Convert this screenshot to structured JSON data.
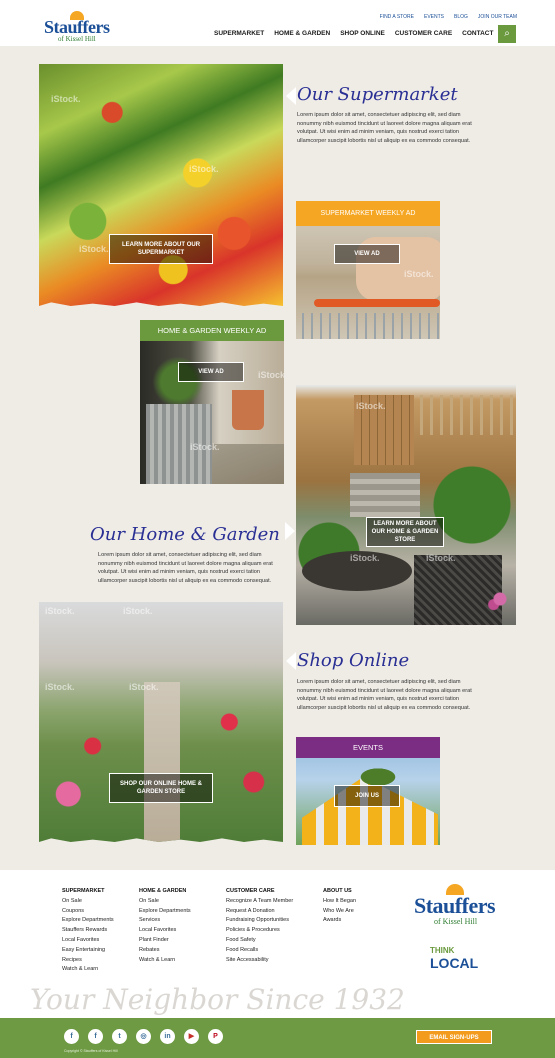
{
  "header": {
    "logo_text": "Stauffers",
    "logo_sub": "of Kissel Hill",
    "utility_links": [
      "FIND A STORE",
      "EVENTS",
      "BLOG",
      "JOIN OUR TEAM"
    ],
    "nav": [
      "SUPERMARKET",
      "HOME & GARDEN",
      "SHOP ONLINE",
      "CUSTOMER CARE",
      "CONTACT"
    ],
    "search_icon": "⌕"
  },
  "watermark": "iStock.",
  "supermarket": {
    "title": "Our Supermarket",
    "body": "Lorem ipsum dolor sit amet, consectetuer adipiscing elit, sed diam nonummy nibh euismod tincidunt ut laoreet dolore magna aliquam erat volutpat. Ut wisi enim ad minim veniam, quis nostrud exerci tation ullamcorper suscipit lobortis nisl ut aliquip ex ea commodo consequat.",
    "button": "LEARN MORE ABOUT OUR SUPERMARKET"
  },
  "supermarket_ad": {
    "label": "SUPERMARKET WEEKLY AD",
    "button": "VIEW AD"
  },
  "garden_ad": {
    "label": "HOME & GARDEN WEEKLY AD",
    "button": "VIEW AD"
  },
  "home_garden": {
    "title": "Our Home & Garden",
    "body": "Lorem ipsum dolor sit amet, consectetuer adipiscing elit, sed diam nonummy nibh euismod tincidunt ut laoreet dolore magna aliquam erat volutpat. Ut wisi enim ad minim veniam, quis nostrud exerci tation ullamcorper suscipit lobortis nisl ut aliquip ex ea commodo consequat.",
    "button": "LEARN MORE ABOUT OUR HOME & GARDEN STORE"
  },
  "shop_online": {
    "title": "Shop Online",
    "body": "Lorem ipsum dolor sit amet, consectetuer adipiscing elit, sed diam nonummy nibh euismod tincidunt ut laoreet dolore magna aliquam erat volutpat. Ut wisi enim ad minim veniam, quis nostrud exerci tation ullamcorper suscipit lobortis nisl ut aliquip ex ea commodo consequat.",
    "button": "SHOP OUR ONLINE HOME & GARDEN STORE"
  },
  "events": {
    "label": "EVENTS",
    "button": "JOIN US"
  },
  "footer": {
    "columns": [
      {
        "heading": "SUPERMARKET",
        "links": [
          "On Sale",
          "Coupons",
          "Explore Departments",
          "Stauffers Rewards",
          "Local Favorites",
          "Easy Entertaining",
          "Recipes",
          "Watch & Learn"
        ]
      },
      {
        "heading": "HOME & GARDEN",
        "links": [
          "On Sale",
          "Explore Departments",
          "Services",
          "Local Favorites",
          "Plant Finder",
          "Rebates",
          "Watch & Learn"
        ]
      },
      {
        "heading": "CUSTOMER CARE",
        "links": [
          "Recognize A Team Member",
          "Request A Donation",
          "Fundraising Opportunities",
          "Policies & Procedures",
          "Food Safety",
          "Food Recalls",
          "Site Accessability"
        ]
      },
      {
        "heading": "ABOUT US",
        "links": [
          "How It Began",
          "Who We Are",
          "Awards"
        ]
      }
    ],
    "logo_text": "Stauffers",
    "logo_sub": "of Kissel Hill",
    "think_local_1": "THINK",
    "think_local_2": "LOCAL",
    "slogan": "Your Neighbor Since 1932",
    "social": [
      "f",
      "f",
      "t",
      "◎",
      "in",
      "▶",
      "P"
    ],
    "email_button": "EMAIL SIGN-UPS",
    "legal": "Copyright © Stauffers of Kissel Hill"
  },
  "colors": {
    "orange": "#f5a623",
    "green": "#6b9a3e",
    "purple": "#7b2c83",
    "navy": "#2a2f94"
  }
}
